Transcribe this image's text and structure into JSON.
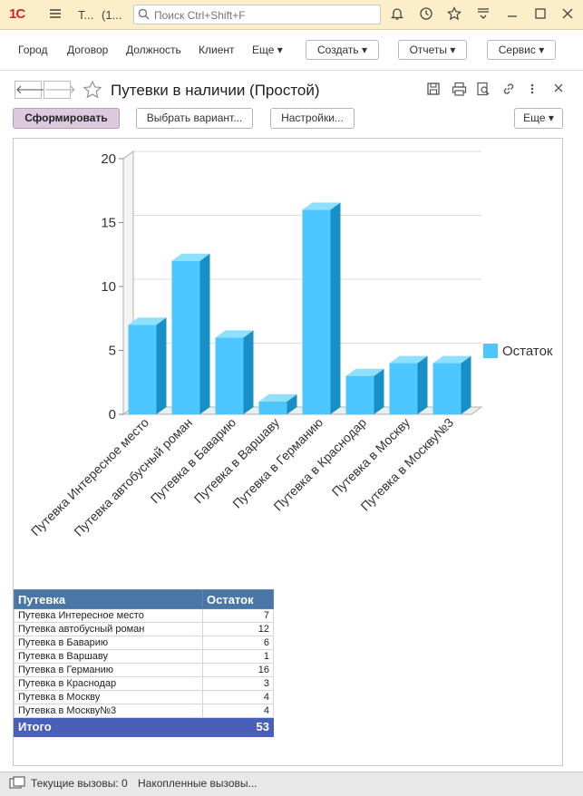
{
  "app": {
    "logo": "1С",
    "title_short": "Т...",
    "title_count": "(1...",
    "search_placeholder": "Поиск Ctrl+Shift+F"
  },
  "menu": {
    "items": [
      "Город",
      "Договор",
      "Должность",
      "Клиент"
    ],
    "more_label": "Еще ▾",
    "buttons": [
      "Создать ▾",
      "Отчеты ▾",
      "Сервис ▾"
    ]
  },
  "form": {
    "back": "🡐",
    "forward": "🡒",
    "title": "Путевки в наличии (Простой)",
    "generate_label": "Сформировать",
    "variant_label": "Выбрать вариант...",
    "settings_label": "Настройки...",
    "more_label": "Еще ▾"
  },
  "chart_data": {
    "type": "bar",
    "categories": [
      "Путевка  Интересное место",
      "Путевка автобусный роман",
      "Путевка в Баварию",
      "Путевка в Варшаву",
      "Путевка в Германию",
      "Путевка в Краснодар",
      "Путевка в Москву",
      "Путевка в Москву№3"
    ],
    "series": [
      {
        "name": "Остаток",
        "values": [
          7,
          12,
          6,
          1,
          16,
          3,
          4,
          4
        ]
      }
    ],
    "ylim": [
      0,
      20
    ],
    "yticks": [
      "0",
      "5",
      "10",
      "15",
      "20"
    ],
    "legend_position": "right",
    "color": "#4dc6ff",
    "grid": true
  },
  "table": {
    "headers": [
      "Путевка",
      "Остаток"
    ],
    "rows": [
      [
        "Путевка  Интересное место",
        "7"
      ],
      [
        "Путевка автобусный роман",
        "12"
      ],
      [
        "Путевка в Баварию",
        "6"
      ],
      [
        "Путевка в Варшаву",
        "1"
      ],
      [
        "Путевка в Германию",
        "16"
      ],
      [
        "Путевка в Краснодар",
        "3"
      ],
      [
        "Путевка в Москву",
        "4"
      ],
      [
        "Путевка в Москву№3",
        "4"
      ]
    ],
    "total_label": "Итого",
    "total_value": "53"
  },
  "status": {
    "current_calls": "Текущие вызовы: 0",
    "accumulated_calls": "Накопленные вызовы..."
  }
}
